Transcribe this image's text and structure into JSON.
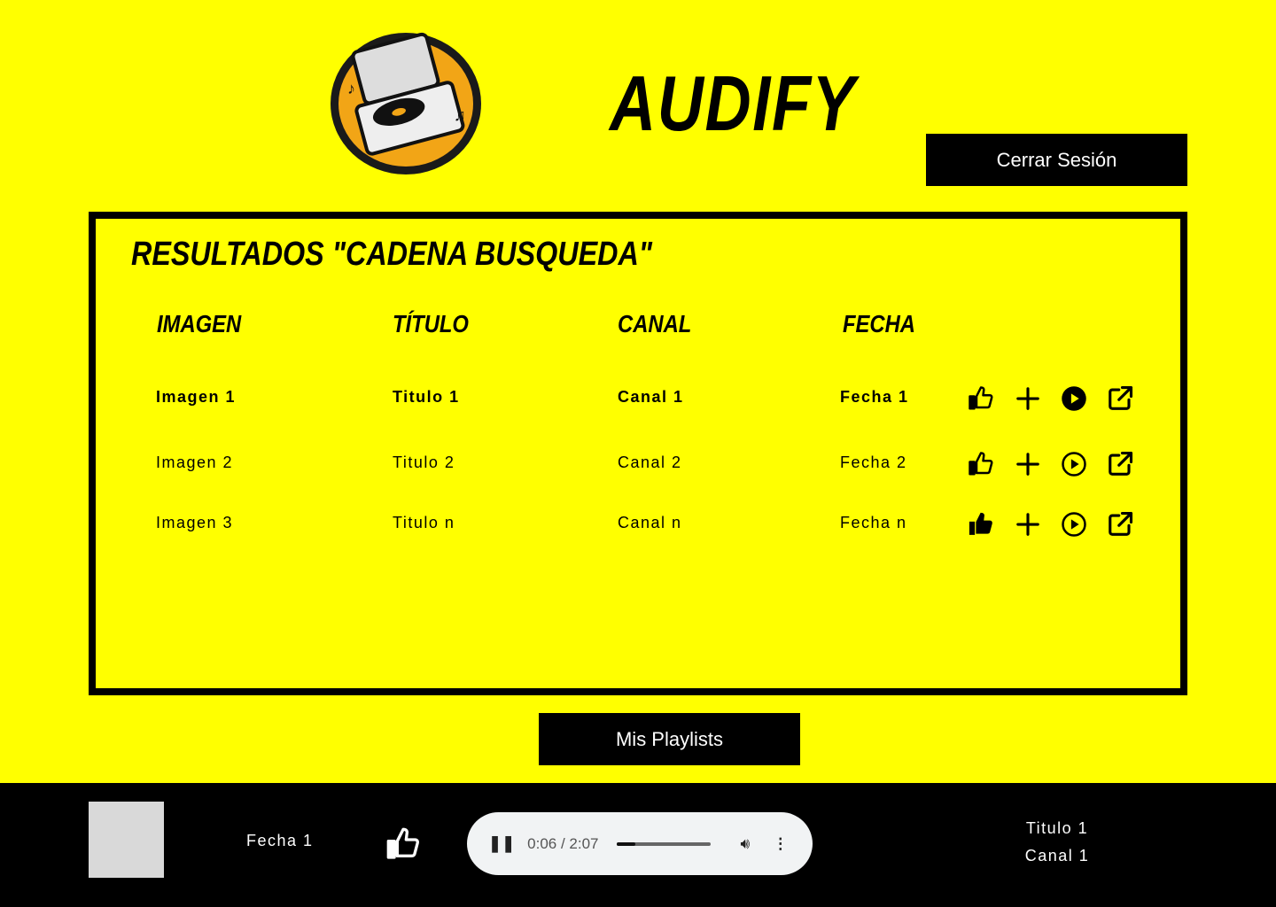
{
  "header": {
    "brand": "AUDIFY",
    "logout_label": "Cerrar Sesión"
  },
  "results": {
    "title": "RESULTADOS \"CADENA BUSQUEDA\"",
    "columns": [
      "IMAGEN",
      "TÍTULO",
      "CANAL",
      "FECHA"
    ],
    "rows": [
      {
        "imagen": "Imagen 1",
        "titulo": "Titulo 1",
        "canal": "Canal 1",
        "fecha": "Fecha 1",
        "liked": false,
        "playing": true
      },
      {
        "imagen": "Imagen 2",
        "titulo": "Titulo 2",
        "canal": "Canal 2",
        "fecha": "Fecha 2",
        "liked": false,
        "playing": false
      },
      {
        "imagen": "Imagen 3",
        "titulo": "Titulo n",
        "canal": "Canal n",
        "fecha": "Fecha n",
        "liked": true,
        "playing": false
      }
    ]
  },
  "playlists_label": "Mis Playlists",
  "now_playing": {
    "fecha": "Fecha 1",
    "titulo": "Titulo 1",
    "canal": "Canal 1",
    "time": "0:06 / 2:07",
    "progress": 0.05
  }
}
